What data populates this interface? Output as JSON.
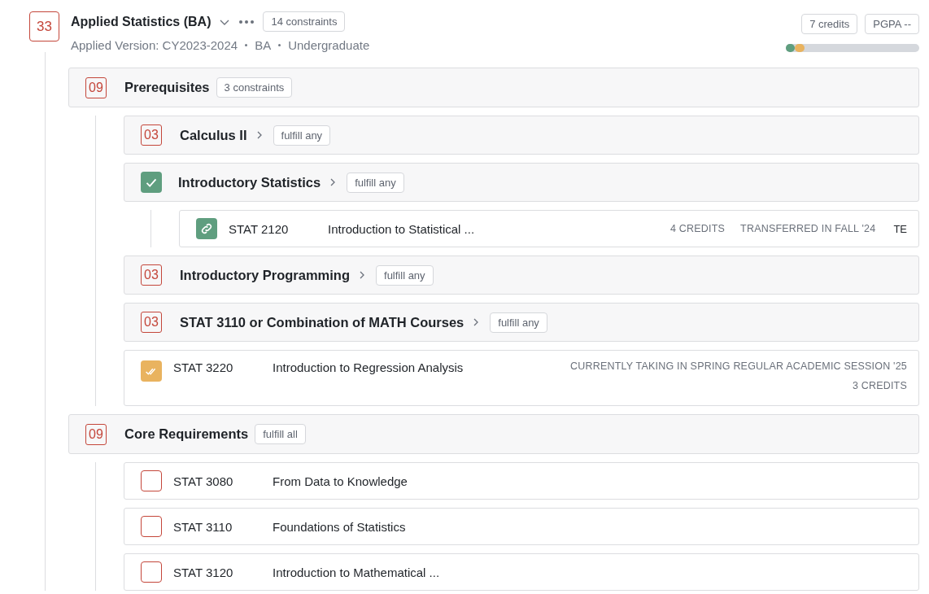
{
  "program": {
    "badge": "33",
    "title": "Applied Statistics (BA)",
    "tag": "14 constraints",
    "meta": [
      "Applied Version: CY2023-2024",
      "BA",
      "Undergraduate"
    ],
    "stats": [
      "7 credits",
      "PGPA --"
    ],
    "progress": [
      {
        "level": 0.07,
        "color": "#5f9e7f"
      },
      {
        "level": 0.07,
        "color": "#e9b35f"
      }
    ]
  },
  "sections": [
    {
      "badge": "09",
      "title": "Prerequisites",
      "tag": "3 constraints",
      "children": [
        {
          "kind": "group",
          "completed": false,
          "badge": "03",
          "title": "Calculus II",
          "tag": "fulfill any"
        },
        {
          "kind": "group",
          "completed": true,
          "title": "Introductory Statistics",
          "tag": "fulfill any",
          "children": [
            {
              "kind": "transferred",
              "code": "STAT 2120",
              "title": "Introduction to Statistical ...",
              "details": [
                "4 CREDITS",
                "TRANSFERRED IN FALL '24"
              ],
              "grade": "TE"
            }
          ]
        },
        {
          "kind": "group",
          "completed": false,
          "badge": "03",
          "title": "Introductory Programming",
          "tag": "fulfill any"
        },
        {
          "kind": "group",
          "completed": false,
          "badge": "03",
          "title": "STAT 3110 or Combination of MATH Courses",
          "tag": "fulfill any"
        },
        {
          "kind": "in_progress",
          "code": "STAT 3220",
          "title": "Introduction to Regression Analysis",
          "details": [
            "CURRENTLY TAKING IN SPRING REGULAR ACADEMIC SESSION '25",
            "3 CREDITS"
          ]
        }
      ]
    },
    {
      "badge": "09",
      "title": "Core Requirements",
      "tag": "fulfill all",
      "children": [
        {
          "kind": "unplanned",
          "code": "STAT 3080",
          "title": "From Data to Knowledge"
        },
        {
          "kind": "unplanned",
          "code": "STAT 3110",
          "title": "Foundations of Statistics"
        },
        {
          "kind": "unplanned",
          "code": "STAT 3120",
          "title": "Introduction to Mathematical ..."
        }
      ]
    }
  ]
}
